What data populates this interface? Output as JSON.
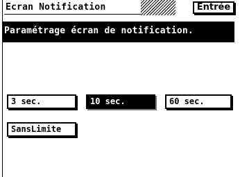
{
  "header": {
    "title": "Ecran Notification",
    "enter_label": "Entrée"
  },
  "message": {
    "text": "Paramétrage écran de notification."
  },
  "options": [
    {
      "label": "3 sec.",
      "selected": false
    },
    {
      "label": "10 sec.",
      "selected": true
    },
    {
      "label": "60 sec.",
      "selected": false
    },
    {
      "label": "SansLimite",
      "selected": false
    }
  ],
  "colors": {
    "foreground": "#000000",
    "background": "#ffffff"
  }
}
